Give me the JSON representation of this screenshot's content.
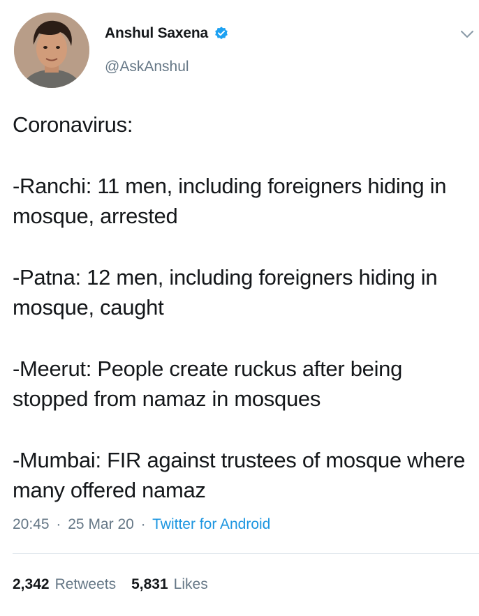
{
  "author": {
    "name": "Anshul Saxena",
    "handle": "@AskAnshul",
    "verified": true,
    "avatar_icon": "profile-photo"
  },
  "tweet": {
    "paragraphs": [
      "Coronavirus:",
      "-Ranchi: 11 men, including foreigners hiding in mosque, arrested",
      "-Patna: 12 men, including foreigners hiding in mosque, caught",
      "-Meerut: People create ruckus after being stopped from namaz in mosques",
      "-Mumbai: FIR against trustees of mosque where many offered namaz"
    ],
    "time": "20:45",
    "date": "25 Mar 20",
    "separator": "·",
    "source": "Twitter for Android"
  },
  "stats": {
    "retweets_count": "2,342",
    "retweets_label": "Retweets",
    "likes_count": "5,831",
    "likes_label": "Likes"
  },
  "colors": {
    "text": "#14171a",
    "secondary": "#657786",
    "link": "#1b95e0",
    "verified": "#1da1f2",
    "divider": "#e1e8ed"
  }
}
